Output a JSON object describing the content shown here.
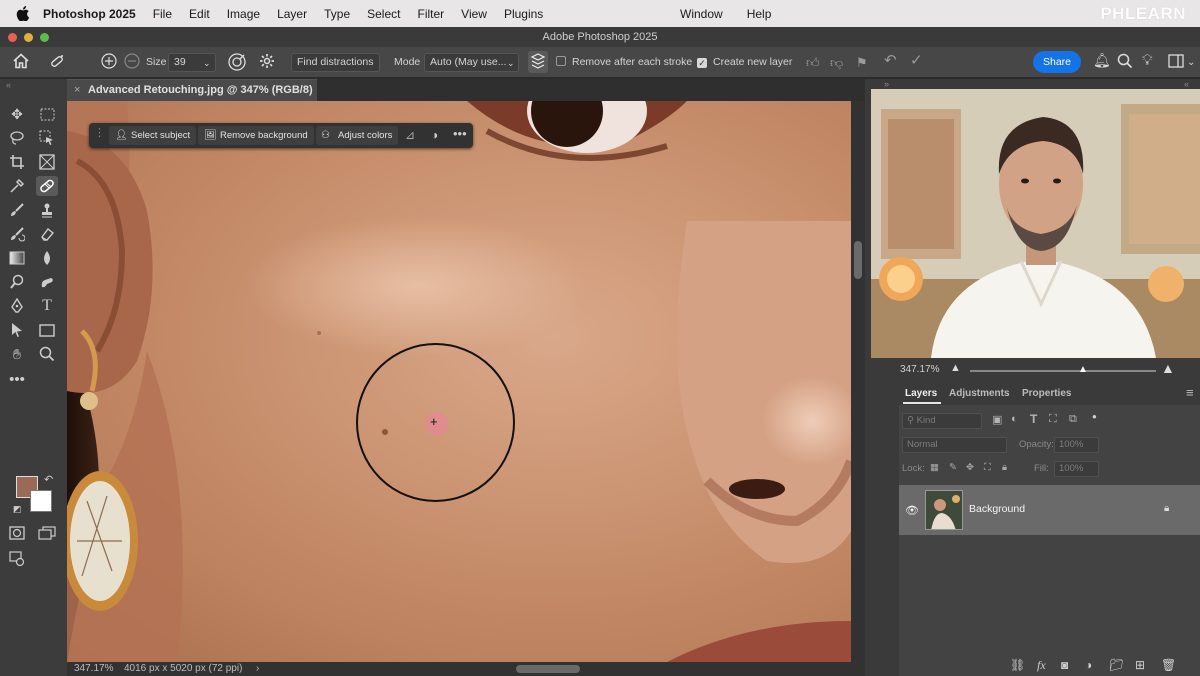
{
  "menubar": {
    "app_name": "Photoshop 2025",
    "items": [
      "File",
      "Edit",
      "Image",
      "Layer",
      "Type",
      "Select",
      "Filter",
      "View",
      "Plugins"
    ],
    "right_items": [
      "Window",
      "Help"
    ],
    "brand": "PHLEARN"
  },
  "window": {
    "title": "Adobe Photoshop 2025"
  },
  "options_bar": {
    "size_label": "Size",
    "size_value": "39",
    "find_distractions": "Find distractions",
    "mode_label": "Mode",
    "mode_value": "Auto (May use...",
    "remove_after_stroke": "Remove after each stroke",
    "remove_after_stroke_checked": false,
    "create_new_layer": "Create new layer",
    "create_new_layer_checked": true,
    "share": "Share"
  },
  "document": {
    "tab_title": "Advanced Retouching.jpg @ 347% (RGB/8) *",
    "status_zoom": "347.17%",
    "status_dimensions": "4016 px x 5020 px (72 ppi)"
  },
  "contextual_taskbar": {
    "select_subject": "Select subject",
    "remove_background": "Remove background",
    "adjust_colors": "Adjust colors"
  },
  "colors": {
    "foreground": "#9b6a56",
    "background": "#ffffff",
    "accent": "#1473e6"
  },
  "navigator": {
    "zoom": "347.17%"
  },
  "layers_panel": {
    "tabs": [
      "Layers",
      "Adjustments",
      "Properties"
    ],
    "active_tab": "Layers",
    "filter_kind": "Kind",
    "blend_mode": "Normal",
    "opacity_label": "Opacity:",
    "opacity_value": "100%",
    "lock_label": "Lock:",
    "fill_label": "Fill:",
    "fill_value": "100%",
    "layers": [
      {
        "name": "Background",
        "visible": true,
        "locked": true
      }
    ]
  }
}
